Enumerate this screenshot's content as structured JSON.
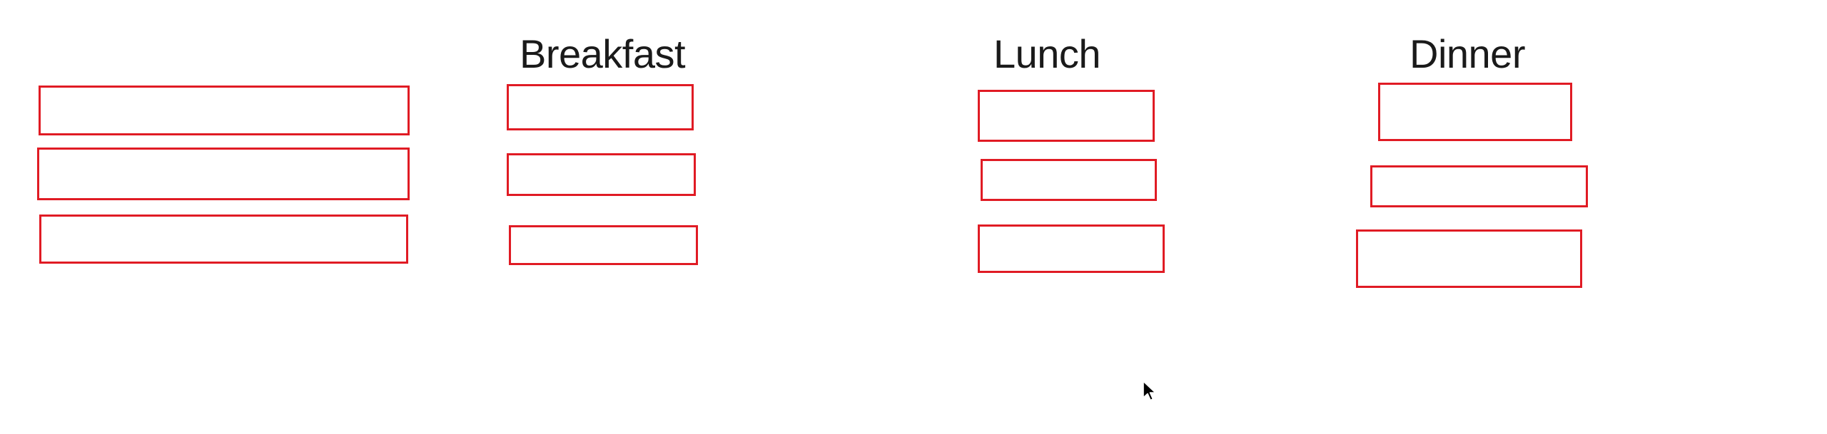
{
  "headings": {
    "breakfast": "Breakfast",
    "lunch": "Lunch",
    "dinner": "Dinner"
  },
  "colors": {
    "background": "#ffffff",
    "box_border": "#e01b24",
    "text": "#1a1a1a",
    "cursor": "#000000"
  },
  "icons": {
    "cursor": "mouse-pointer-icon"
  }
}
